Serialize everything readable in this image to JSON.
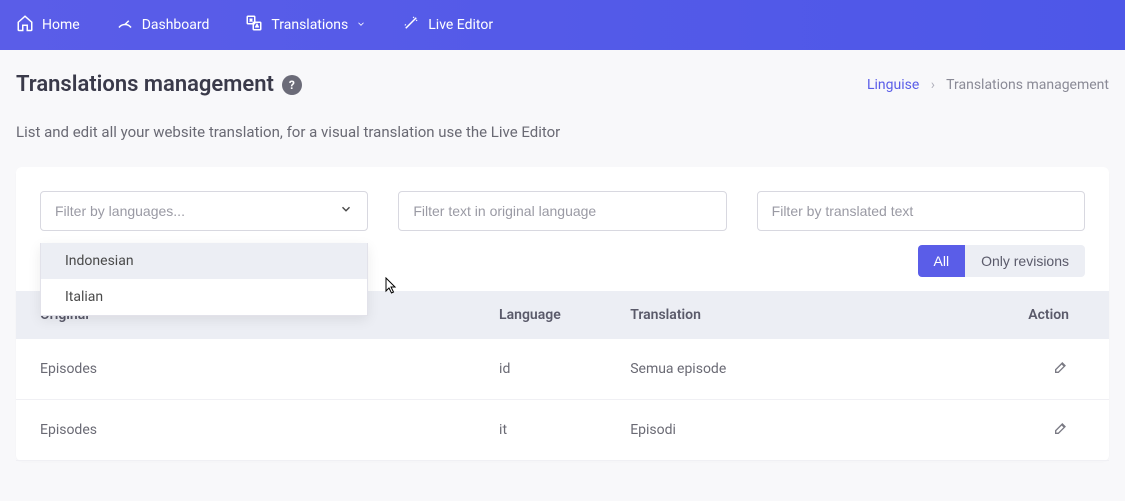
{
  "nav": {
    "home": "Home",
    "dashboard": "Dashboard",
    "translations": "Translations",
    "live_editor": "Live Editor"
  },
  "page": {
    "title": "Translations management",
    "help_glyph": "?",
    "subtitle": "List and edit all your website translation, for a visual translation use the Live Editor"
  },
  "breadcrumb": {
    "root": "Linguise",
    "sep": "›",
    "current": "Translations management"
  },
  "filters": {
    "language_placeholder": "Filter by languages...",
    "original_placeholder": "Filter text in original language",
    "translated_placeholder": "Filter by translated text",
    "dropdown": {
      "opt0": "Indonesian",
      "opt1": "Italian"
    }
  },
  "toggle": {
    "all": "All",
    "revisions": "Only revisions"
  },
  "table": {
    "headers": {
      "original": "Original",
      "language": "Language",
      "translation": "Translation",
      "action": "Action"
    },
    "rows": {
      "r0": {
        "original": "Episodes",
        "language": "id",
        "translation": "Semua episode"
      },
      "r1": {
        "original": "Episodes",
        "language": "it",
        "translation": "Episodi"
      }
    }
  }
}
